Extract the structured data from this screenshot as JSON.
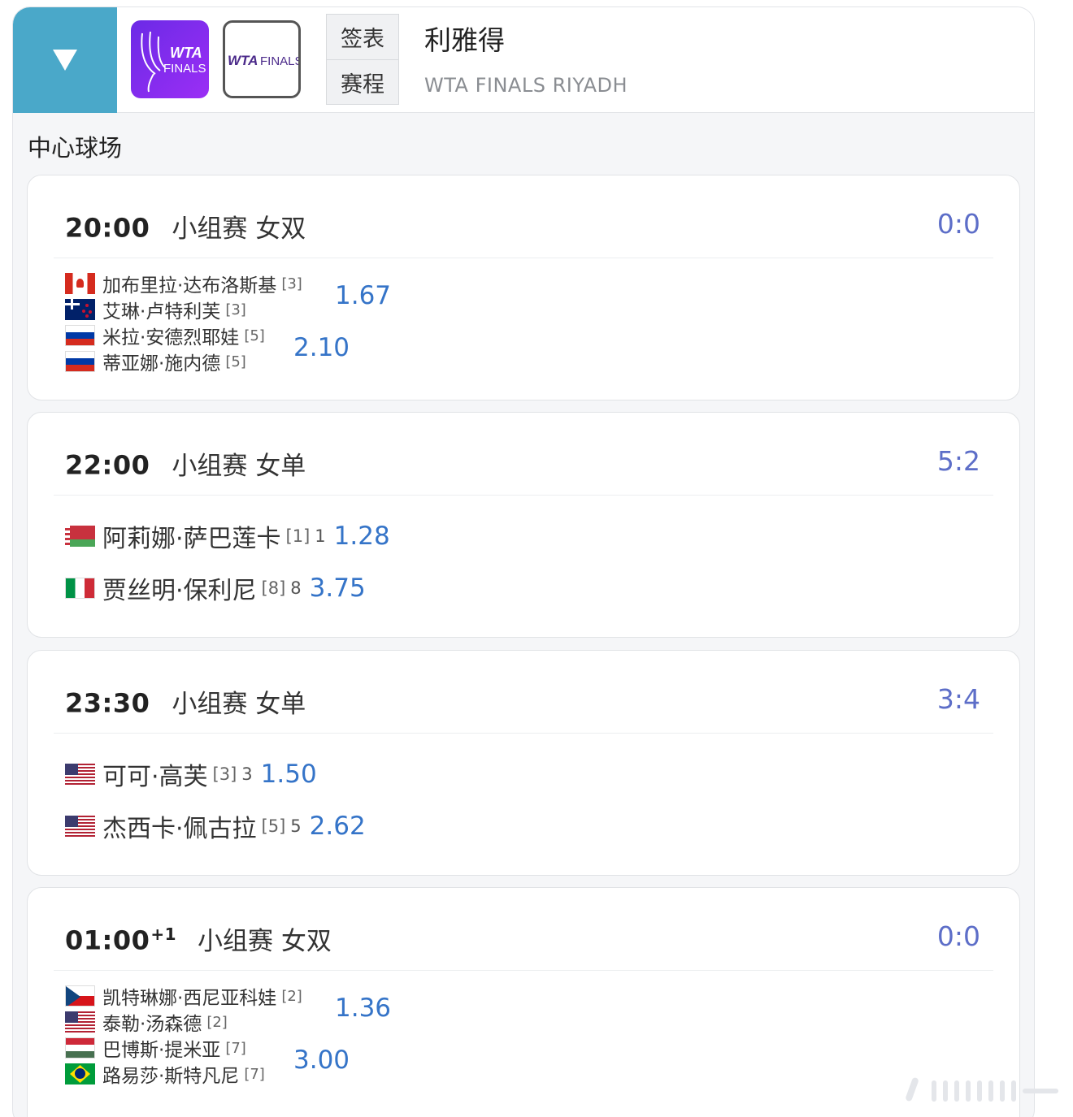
{
  "header": {
    "logo1_text": "WTA",
    "logo1_sub": "FINALS",
    "logo2_text": "WTA",
    "logo2_sub": "FINALS",
    "nav": [
      {
        "label": "签表"
      },
      {
        "label": "赛程"
      }
    ],
    "title": "利雅得",
    "subtitle": "WTA FINALS RIYADH"
  },
  "court": "中心球场",
  "matches": [
    {
      "time": "20:00",
      "time_suffix": "",
      "round": "小组赛 女双",
      "score": "0:0",
      "players": [
        {
          "flag": "ca",
          "name": "加布里拉·达布洛斯基",
          "seed": "[3]"
        },
        {
          "flag": "nz",
          "name": "艾琳·卢特利芙",
          "seed": "[3]"
        },
        {
          "flag": "ru",
          "name": "米拉·安德烈耶娃",
          "seed": "[5]"
        },
        {
          "flag": "ru",
          "name": "蒂亚娜·施内德",
          "seed": "[5]"
        }
      ],
      "odds": [
        "1.67",
        "2.10"
      ]
    },
    {
      "time": "22:00",
      "time_suffix": "",
      "round": "小组赛 女单",
      "score": "5:2",
      "players": [
        {
          "flag": "by",
          "name": "阿莉娜·萨巴莲卡",
          "seed": "[1]",
          "extra": "1",
          "odds": "1.28"
        },
        {
          "flag": "it",
          "name": "贾丝明·保利尼",
          "seed": "[8]",
          "extra": "8",
          "odds": "3.75"
        }
      ]
    },
    {
      "time": "23:30",
      "time_suffix": "",
      "round": "小组赛 女单",
      "score": "3:4",
      "players": [
        {
          "flag": "us",
          "name": "可可·高芙",
          "seed": "[3]",
          "extra": "3",
          "odds": "1.50"
        },
        {
          "flag": "us",
          "name": "杰西卡·佩古拉",
          "seed": "[5]",
          "extra": "5",
          "odds": "2.62"
        }
      ]
    },
    {
      "time": "01:00",
      "time_suffix": "+1",
      "round": "小组赛 女双",
      "score": "0:0",
      "players": [
        {
          "flag": "cz",
          "name": "凯特琳娜·西尼亚科娃",
          "seed": "[2]"
        },
        {
          "flag": "us",
          "name": "泰勒·汤森德",
          "seed": "[2]"
        },
        {
          "flag": "hu",
          "name": "巴博斯·提米亚",
          "seed": "[7]"
        },
        {
          "flag": "br",
          "name": "路易莎·斯特凡尼",
          "seed": "[7]"
        }
      ],
      "odds": [
        "1.36",
        "3.00"
      ]
    }
  ],
  "colors": {
    "accent_teal": "#4aa8c9",
    "score_blue": "#5d6ec8",
    "odds_blue": "#3574c8",
    "logo_purple": "#7b2cf0"
  },
  "icons": {
    "dropdown": "triangle-down-icon"
  }
}
